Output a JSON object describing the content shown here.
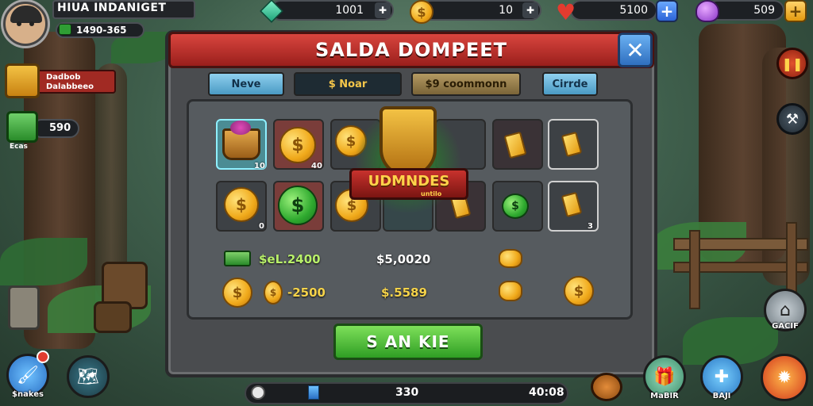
{
  "player": {
    "name": "HIUA INDANIGET",
    "currency": "1490-365"
  },
  "top_bar": {
    "gems": "1001",
    "coins": "10",
    "hearts": "5100",
    "purple": "509"
  },
  "left_panel": {
    "item1_line1": "Dadbob",
    "item1_line2": "Dalabbeeo",
    "item2_value": "590",
    "item2_caption": "Ecas"
  },
  "dialog": {
    "title": "SALDA DOMPEET",
    "close_symbol": "✕",
    "tabs": [
      "Neve",
      "$ Noar",
      "$9 coommonn",
      "Cirrde"
    ],
    "emblem_text": "UDMNDES",
    "emblem_sub": "untilo",
    "slot_quantities": {
      "basket": "10",
      "coin_r1": "40",
      "coin_r2": "0",
      "bar_r2": "3"
    },
    "row1": {
      "label": "$eL.2400",
      "value": "$5,0020"
    },
    "row2": {
      "label": "-2500",
      "value": "$.5589"
    },
    "cta_label": "S AN KIE"
  },
  "bottom_bar": {
    "left_value": "330",
    "right_value": "40:08"
  },
  "left_buttons": [
    {
      "label": "$nakes"
    }
  ],
  "right_buttons": [
    {
      "label": "GACIF"
    },
    {
      "label": "MaBIR"
    },
    {
      "label": "BAJI"
    }
  ],
  "colors": {
    "banner": "#c8322d",
    "cta": "#4cbb2c",
    "plus_button": "#3c78e6"
  }
}
